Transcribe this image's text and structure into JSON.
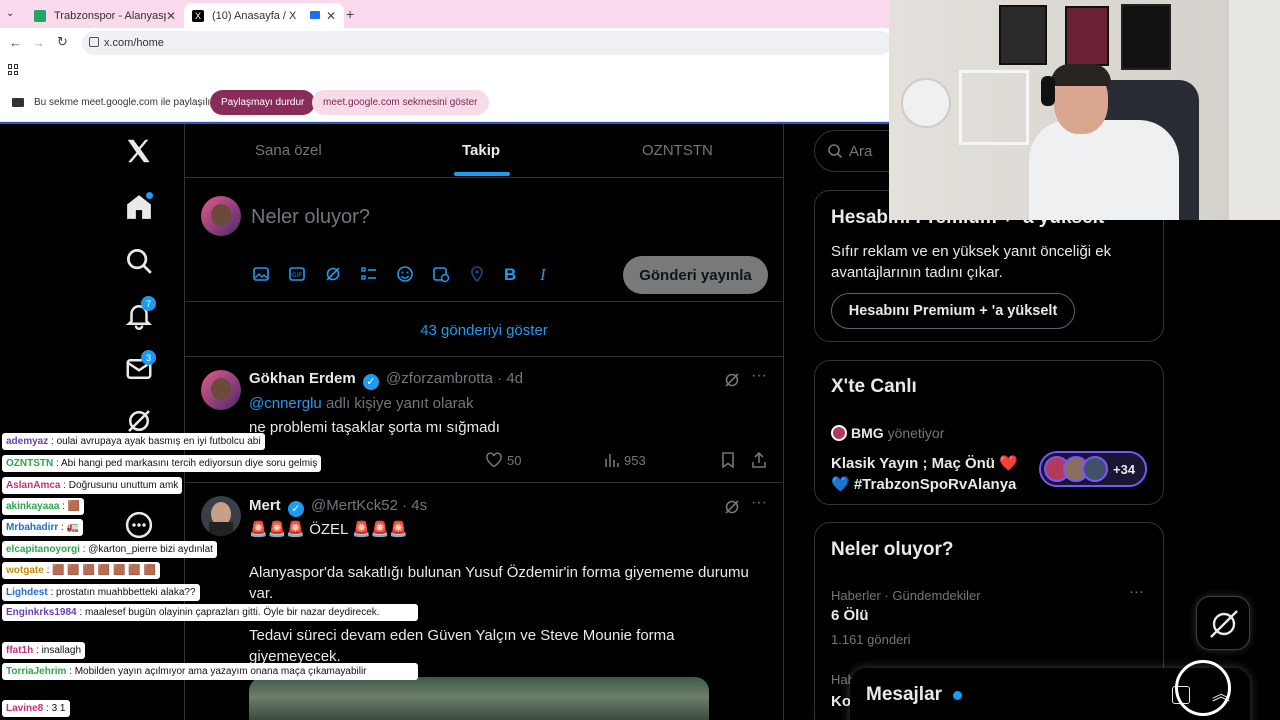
{
  "browser": {
    "tabs": [
      {
        "title": "Trabzonspor - Alanyaspor canlı",
        "active": false
      },
      {
        "title": "(10) Anasayfa / X",
        "active": true
      }
    ],
    "url": "x.com/home"
  },
  "sharebar": {
    "message": "Bu sekme meet.google.com ile paylaşılıyor",
    "stop_label": "Paylaşmayı durdur",
    "show_label": "meet.google.com sekmesini göster"
  },
  "nav": {
    "notifications_badge": "7",
    "messages_badge": "3"
  },
  "timeline_tabs": [
    {
      "label": "Sana özel",
      "active": false
    },
    {
      "label": "Takip",
      "active": true
    },
    {
      "label": "OZNTSTN",
      "active": false
    }
  ],
  "composer": {
    "placeholder": "Neler oluyor?",
    "post_button": "Gönderi yayınla"
  },
  "show_more": "43 gönderiyi göster",
  "posts": [
    {
      "name": "Gökhan Erdem",
      "handle": "@zforzambrotta",
      "time": "· 4d",
      "reply_to": "@cnnerglu",
      "reply_suffix": "adlı kişiye yanıt olarak",
      "text": "ne problemi taşaklar şorta mı sığmadı",
      "likes": "50",
      "views": "953"
    },
    {
      "name": "Mert",
      "handle": "@MertKck52",
      "time": "· 4s",
      "line1": "🚨🚨🚨 ÖZEL 🚨🚨🚨",
      "line2": "Alanyaspor'da sakatlığı bulunan Yusuf Özdemir'in forma giyememe durumu var.",
      "line3": "Tedavi süreci devam eden Güven Yalçın ve Steve Mounie forma giyemeyecek."
    }
  ],
  "search_placeholder": "Ara",
  "premium": {
    "title": "Hesabını Premium + 'a yükselt",
    "description": "Sıfır reklam ve en yüksek yanıt önceliği ek avantajlarının tadını çıkar.",
    "button": "Hesabını Premium + 'a yükselt"
  },
  "live": {
    "title": "X'te Canlı",
    "host": "BMG",
    "host_suffix": "yönetiyor",
    "space_title": "Klasik Yayın ; Maç Önü ❤️ 💙 #TrabzonSpoRvAlanya",
    "listeners": "+34"
  },
  "trends": {
    "title": "Neler oluyor?",
    "items": [
      {
        "category": "Haberler · Gündemdekiler",
        "name": "6 Ölü",
        "count": "1.161 gönderi"
      },
      {
        "category": "Hab",
        "name": "Ko",
        "count": ""
      }
    ]
  },
  "messages_label": "Mesajlar",
  "chat": [
    {
      "user": "ademyaz",
      "msg": ": oulai avrupaya ayak basmış en iyi futbolcu abi",
      "color": "#6a3fb5"
    },
    {
      "user": "OZNTSTN",
      "msg": ": Abi hangi ped markasını tercih ediyorsun diye soru gelmiş",
      "color": "#2aa84a"
    },
    {
      "user": "AslanAmca",
      "msg": ": Doğrusunu unuttum amk",
      "color": "#c9307a"
    },
    {
      "user": "akinkayaaa",
      "msg": ": 🟫",
      "color": "#2aa84a"
    },
    {
      "user": "Mrbahadirr",
      "msg": ": 🚛",
      "color": "#1f6fd1"
    },
    {
      "user": "elcapitanoyorgi",
      "msg": ": @karton_pierre bizi aydınlat",
      "color": "#2aa84a"
    },
    {
      "user": "wotgate",
      "msg": ": 🟫 🟫 🟫 🟫 🟫 🟫 🟫",
      "color": "#c98a00"
    },
    {
      "user": "Lighdest",
      "msg": ": prostatın muahbbetteki alaka??",
      "color": "#1f6fd1"
    },
    {
      "user": "Enginkrks1984",
      "msg": ": maalesef bugün olayinin çaprazları gitti. Öyle bir nazar deydirecek.",
      "color": "#6a3fb5"
    },
    {
      "user": "ffat1h",
      "msg": ": insallagh",
      "color": "#c9307a"
    },
    {
      "user": "TorriaJehrim",
      "msg": ": Mobilden yayın açılmıyor ama yazayım onana maça çıkamayabilir",
      "color": "#2aa84a"
    },
    {
      "user": "Lavine8",
      "msg": ": 3 1",
      "color": "#c9307a"
    }
  ],
  "colors": {
    "accent": "#1d9bf0",
    "share_stop": "#8a2c5a",
    "tabbar": "#f9d9ec"
  }
}
